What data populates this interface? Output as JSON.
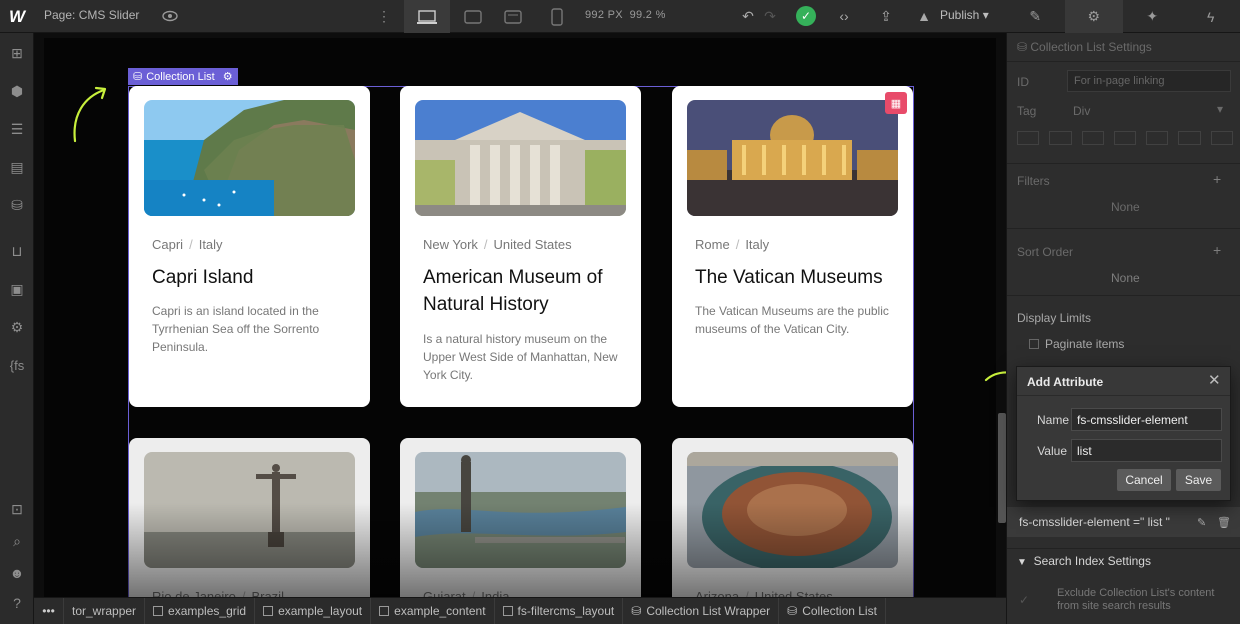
{
  "topbar": {
    "page_label": "Page: CMS Slider",
    "viewport_width": "992 PX",
    "zoom": "99.2 %",
    "publish_label": "Publish"
  },
  "canvas": {
    "collection_badge": "Collection List",
    "cards": [
      {
        "city": "Capri",
        "country": "Italy",
        "title": "Capri Island",
        "description": "Capri is an island located in the Tyrrhenian Sea off the Sorrento Peninsula."
      },
      {
        "city": "New York",
        "country": "United States",
        "title": "American Museum of Natural History",
        "description": "Is a natural history museum on the Upper West Side of Manhattan, New York City."
      },
      {
        "city": "Rome",
        "country": "Italy",
        "title": "The Vatican Museums",
        "description": "The Vatican Museums are the public museums of the Vatican City."
      },
      {
        "city": "Rio de Janeiro",
        "country": "Brazil"
      },
      {
        "city": "Gujarat",
        "country": "India"
      },
      {
        "city": "Arizona",
        "country": "United States"
      }
    ]
  },
  "breadcrumbs": [
    "tor_wrapper",
    "examples_grid",
    "example_layout",
    "example_content",
    "fs-filtercms_layout",
    "Collection List Wrapper",
    "Collection List"
  ],
  "panel": {
    "header": "Collection List Settings",
    "id_label": "ID",
    "id_placeholder": "For in-page linking",
    "tag_label": "Tag",
    "tag_value": "Div",
    "filters_label": "Filters",
    "filters_value": "None",
    "sort_label": "Sort Order",
    "sort_value": "None",
    "display_limits_label": "Display Limits",
    "paginate_label": "Paginate items",
    "attribute_text": "fs-cmsslider-element =\" list \"",
    "search_index_label": "Search Index Settings",
    "exclude_label": "Exclude Collection List's content from site search results"
  },
  "modal": {
    "title": "Add Attribute",
    "name_label": "Name",
    "name_value": "fs-cmsslider-element",
    "value_label": "Value",
    "value_value": "list",
    "cancel_label": "Cancel",
    "save_label": "Save"
  },
  "colors": {
    "accent": "#6b5fd6",
    "arrow": "#c8f03c",
    "edit_badge": "#e84b6a",
    "status_ok": "#35b15a"
  }
}
